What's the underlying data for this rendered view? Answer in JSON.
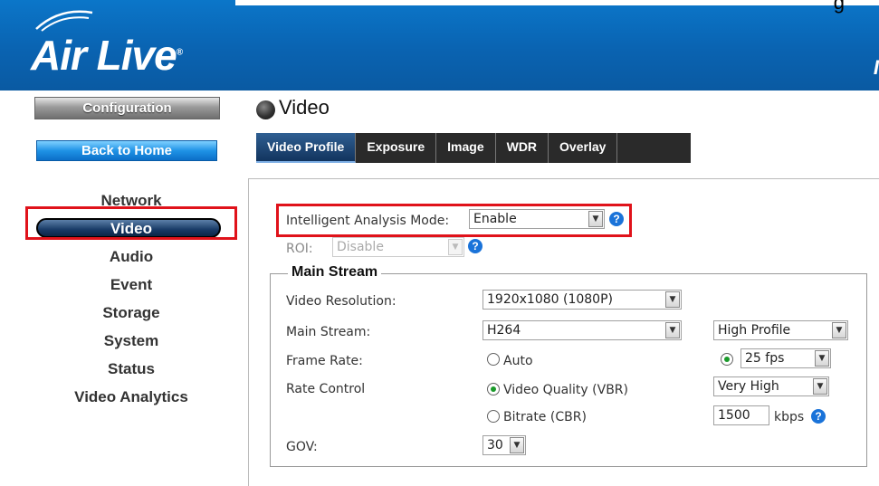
{
  "header": {
    "logo_text": "Air Live",
    "logo_mark": "®",
    "right_letter": "I",
    "top_right_text": "g"
  },
  "sidebar": {
    "config_label": "Configuration",
    "home_label": "Back to Home",
    "items": [
      "Network",
      "Video",
      "Audio",
      "Event",
      "Storage",
      "System",
      "Status",
      "Video Analytics"
    ],
    "active": "Video"
  },
  "page": {
    "title": "Video"
  },
  "tabs": [
    "Video Profile",
    "Exposure",
    "Image",
    "WDR",
    "Overlay"
  ],
  "form": {
    "mode_label": "Intelligent Analysis Mode:",
    "mode_value": "Enable",
    "roi_label": "ROI:",
    "roi_value": "Disable",
    "section_title": "Main Stream",
    "resolution_label": "Video Resolution:",
    "resolution_value": "1920x1080 (1080P)",
    "stream_label": "Main Stream:",
    "stream_value": "H264",
    "profile_value": "High Profile",
    "frame_rate_label": "Frame Rate:",
    "frame_rate_auto": "Auto",
    "frame_rate_value": "25 fps",
    "rate_control_label": "Rate Control",
    "vbr_label": "Video Quality (VBR)",
    "vbr_value": "Very High",
    "cbr_label": "Bitrate (CBR)",
    "bitrate_value": "1500",
    "bitrate_unit": "kbps",
    "gov_label": "GOV:",
    "gov_value": "30"
  },
  "icons": {
    "help": "?",
    "dropdown": "▼"
  },
  "colors": {
    "highlight": "#e0121a",
    "brand": "#0a63b1"
  }
}
